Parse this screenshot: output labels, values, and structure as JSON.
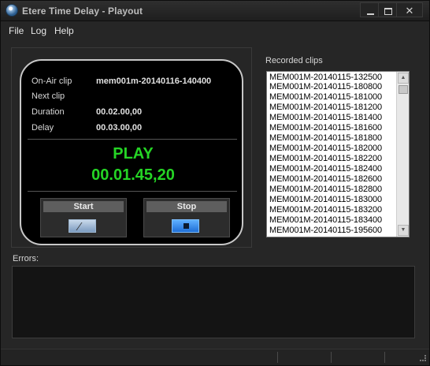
{
  "window": {
    "title": "Etere Time Delay - Playout"
  },
  "menu": [
    "File",
    "Log",
    "Help"
  ],
  "onair": {
    "labels": {
      "on_air_clip": "On-Air clip",
      "next_clip": "Next clip",
      "duration": "Duration",
      "delay": "Delay"
    },
    "values": {
      "on_air_clip": "mem001m-20140116-140400",
      "next_clip": "",
      "duration": "00.02.00,00",
      "delay": "00.03.00,00"
    },
    "status": "PLAY",
    "time": "00.01.45,20",
    "status_color": "#25d425"
  },
  "controls": {
    "start_label": "Start",
    "stop_label": "Stop"
  },
  "recorded": {
    "label": "Recorded clips",
    "clips": [
      "MEM001M-20140115-132500",
      "MEM001M-20140115-180800",
      "MEM001M-20140115-181000",
      "MEM001M-20140115-181200",
      "MEM001M-20140115-181400",
      "MEM001M-20140115-181600",
      "MEM001M-20140115-181800",
      "MEM001M-20140115-182000",
      "MEM001M-20140115-182200",
      "MEM001M-20140115-182400",
      "MEM001M-20140115-182600",
      "MEM001M-20140115-182800",
      "MEM001M-20140115-183000",
      "MEM001M-20140115-183200",
      "MEM001M-20140115-183400",
      "MEM001M-20140115-195600"
    ]
  },
  "errors": {
    "label": "Errors:"
  }
}
